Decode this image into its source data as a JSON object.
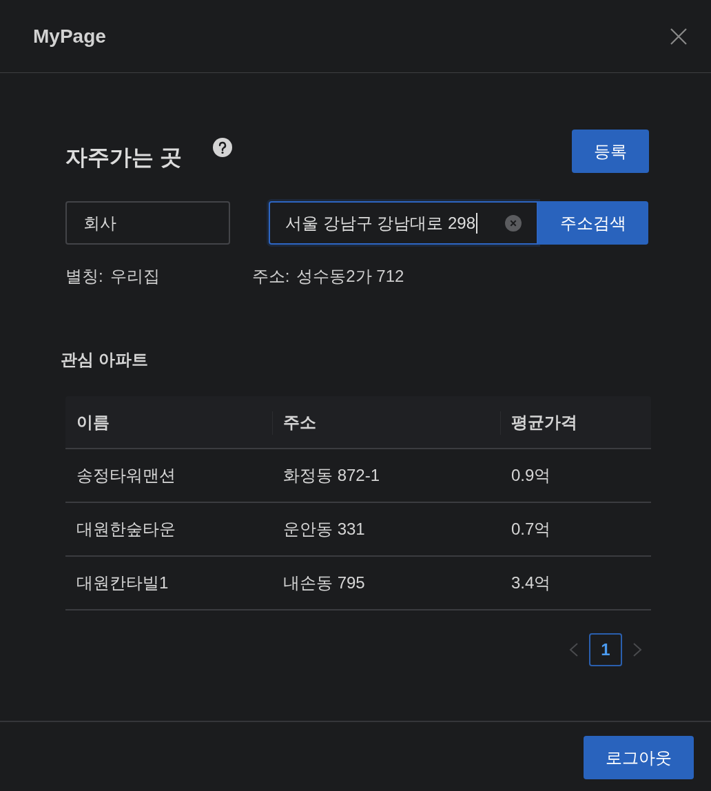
{
  "dialog": {
    "title": "MyPage"
  },
  "favorites": {
    "title": "자주가는 곳",
    "register_button": "등록",
    "alias_field": {
      "value": "회사"
    },
    "address_field": {
      "value": "서울 강남구 강남대로 298",
      "focused": true
    },
    "search_button": "주소검색",
    "alias_info": {
      "label": "별칭:",
      "value": "우리집"
    },
    "address_info": {
      "label": "주소:",
      "value": "성수동2가 712"
    }
  },
  "apartments": {
    "title": "관심 아파트",
    "columns": [
      "이름",
      "주소",
      "평균가격"
    ],
    "rows": [
      [
        "송정타워맨션",
        "화정동 872-1",
        "0.9억"
      ],
      [
        "대원한숲타운",
        "운안동 331",
        "0.7억"
      ],
      [
        "대원칸타빌1",
        "내손동 795",
        "3.4억"
      ]
    ],
    "pagination": {
      "previous": {
        "disabled": true
      },
      "pages": [
        {
          "label": "1",
          "selected": true
        }
      ],
      "next": {
        "disabled": true
      }
    }
  },
  "footer": {
    "logout_button": "로그아웃"
  }
}
